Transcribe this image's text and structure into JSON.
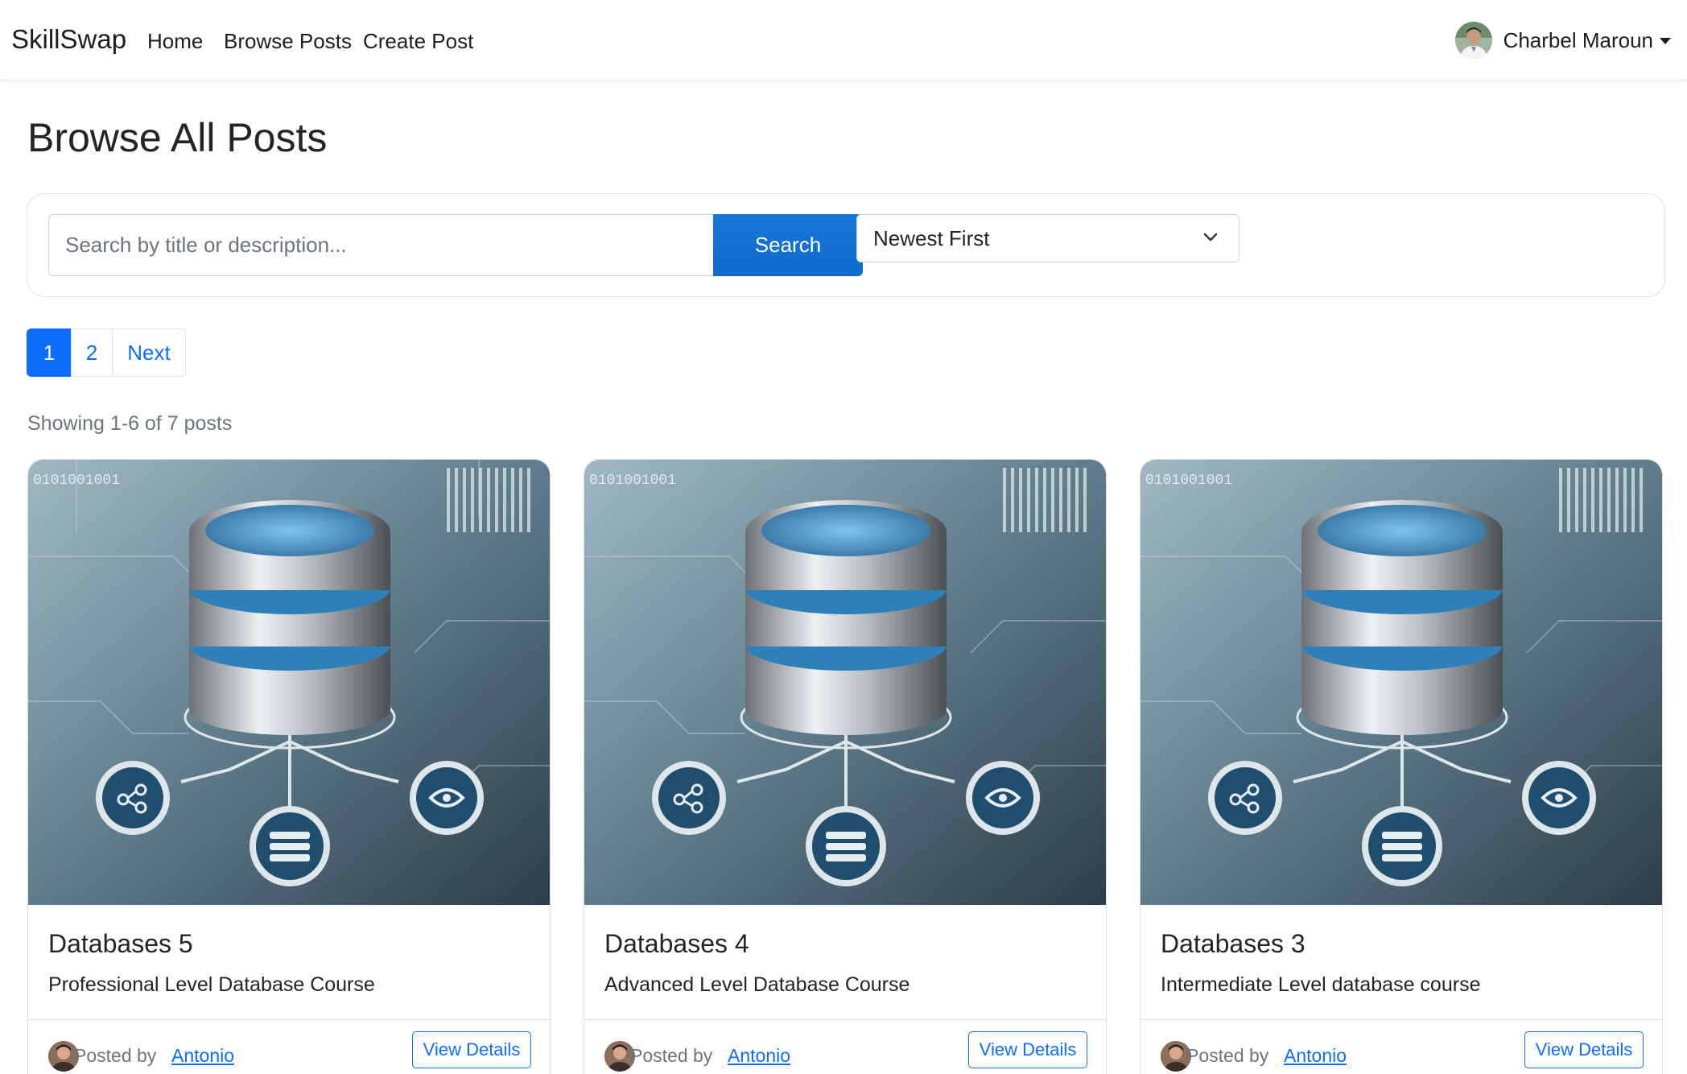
{
  "nav": {
    "brand": "SkillSwap",
    "links": [
      "Home",
      "Browse Posts",
      "Create Post"
    ],
    "user_name": "Charbel Maroun"
  },
  "page_title": "Browse All Posts",
  "search": {
    "placeholder": "Search by title or description...",
    "button_label": "Search",
    "sort_selected": "Newest First"
  },
  "pagination": {
    "pages": [
      "1",
      "2"
    ],
    "next_label": "Next",
    "active_page": "1"
  },
  "results_text": "Showing 1-6 of 7 posts",
  "posts": [
    {
      "title": "Databases 5",
      "description": "Professional Level Database Course",
      "posted_by_label": "Posted by",
      "author": "Antonio",
      "action_label": "View Details"
    },
    {
      "title": "Databases 4",
      "description": "Advanced Level Database Course",
      "posted_by_label": "Posted by",
      "author": "Antonio",
      "action_label": "View Details"
    },
    {
      "title": "Databases 3",
      "description": "Intermediate Level database course",
      "posted_by_label": "Posted by",
      "author": "Antonio",
      "action_label": "View Details"
    }
  ],
  "colors": {
    "primary": "#0d6efd",
    "search_button": "#1571d3",
    "text": "#212529",
    "muted": "#6c757d",
    "border": "#dcdfe3"
  },
  "icons": [
    "user-avatar-icon",
    "caret-down-icon",
    "chevron-down-icon",
    "database-icon",
    "author-avatar-icon"
  ]
}
